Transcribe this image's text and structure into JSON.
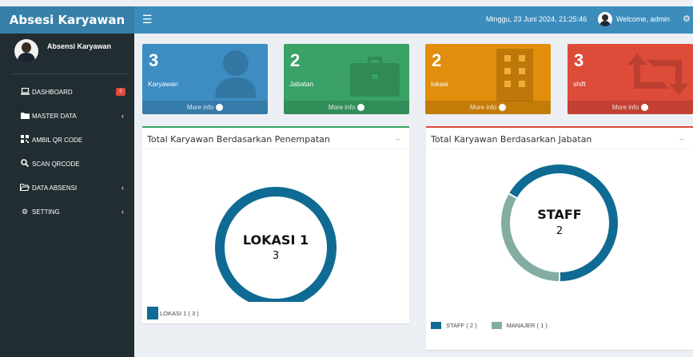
{
  "app": {
    "title": "Absesi Karyawan"
  },
  "topbar": {
    "datetime": "Minggu, 23 Juni 2024, 21:25:46",
    "welcome": "Welcome, admin",
    "menu_icon": "hamburger-icon",
    "settings_icon": "gears-icon"
  },
  "sidebar": {
    "user_name": "Absensi Karyawan",
    "items": [
      {
        "label": "DASHBOARD",
        "icon": "laptop-icon",
        "badge": "0"
      },
      {
        "label": "MASTER DATA",
        "icon": "folder-icon",
        "chevron": "‹"
      },
      {
        "label": "AMBIL QR CODE",
        "icon": "qrcode-icon"
      },
      {
        "label": "SCAN QRCODE",
        "icon": "search-icon"
      },
      {
        "label": "DATA ABSENSI",
        "icon": "folder-open-icon",
        "chevron": "‹"
      },
      {
        "label": "SETTING",
        "icon": "gears-icon",
        "chevron": "‹"
      }
    ]
  },
  "boxes": [
    {
      "count": "3",
      "label": "Karyawan",
      "more": "More info",
      "color": "#3d8dc2",
      "icon": "user-icon"
    },
    {
      "count": "2",
      "label": "Jabatan",
      "more": "More info",
      "color": "#3aa266",
      "icon": "briefcase-icon"
    },
    {
      "count": "2",
      "label": "lokasi",
      "more": "More info",
      "color": "#e08e0b",
      "icon": "building-icon"
    },
    {
      "count": "3",
      "label": "shift",
      "more": "More info",
      "color": "#dd4b39",
      "icon": "retweet-icon"
    }
  ],
  "panels": {
    "penempatan": {
      "title": "Total Karyawan Berdasarkan Penempatan",
      "collapse": "–"
    },
    "jabatan": {
      "title": "Total Karyawan Berdasarkan Jabatan",
      "collapse": "–"
    }
  },
  "chart_data": [
    {
      "type": "pie",
      "title": "Total Karyawan Berdasarkan Penempatan",
      "categories": [
        "LOKASI 1"
      ],
      "values": [
        3
      ],
      "colors": [
        "#0f6b93"
      ],
      "center_label": "LOKASI 1",
      "center_value": "3",
      "legend": [
        {
          "label": "LOKASI 1 ( 3 )",
          "color": "#0f6b93"
        }
      ]
    },
    {
      "type": "pie",
      "title": "Total Karyawan Berdasarkan Jabatan",
      "categories": [
        "STAFF",
        "MANAJER"
      ],
      "values": [
        2,
        1
      ],
      "colors": [
        "#0f6b93",
        "#83ada2"
      ],
      "center_label": "STAFF",
      "center_value": "2",
      "legend": [
        {
          "label": "STAFF ( 2 )",
          "color": "#0f6b93"
        },
        {
          "label": "MANAJER ( 1 )",
          "color": "#83ada2"
        }
      ]
    }
  ]
}
